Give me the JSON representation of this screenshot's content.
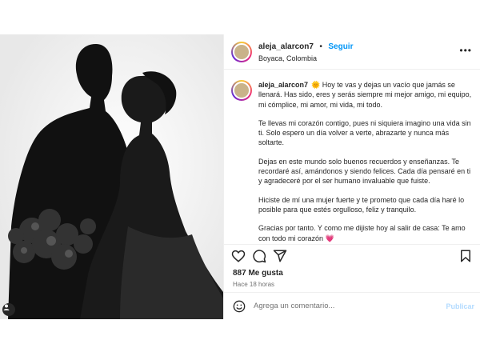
{
  "post": {
    "username": "aleja_alarcon7",
    "separator": "•",
    "follow_label": "Seguir",
    "location": "Boyaca, Colombia",
    "more_icon": "more-horizontal-icon",
    "tag_icon": "user-tag-icon"
  },
  "caption": {
    "username": "aleja_alarcon7",
    "paragraphs": [
      "🌞 Hoy te vas y dejas un vacío que jamás se llenará. Has sido, eres y serás siempre mi mejor amigo, mi equipo, mi cómplice, mi amor, mi vida, mi todo.",
      "Te llevas mi corazón contigo, pues ni siquiera imagino una vida sin ti. Solo espero un día volver a verte, abrazarte y nunca más soltarte.",
      "Dejas en este mundo solo buenos recuerdos y enseñanzas. Te recordaré así, amándonos y siendo felices. Cada día pensaré en ti y agradeceré por el ser humano invaluable que fuiste.",
      "Hiciste de mí una mujer fuerte y te prometo que cada día haré lo posible para que estés orgulloso, feliz y tranquilo.",
      "Gracias por tanto. Y como me dijiste hoy al salir de casa: Te amo con todo mi corazón 💗"
    ]
  },
  "actions": {
    "like_icon": "heart-icon",
    "comment_icon": "comment-icon",
    "share_icon": "share-icon",
    "save_icon": "bookmark-icon"
  },
  "stats": {
    "likes": "887 Me gusta",
    "time": "Hace 18 horas"
  },
  "comment": {
    "emoji_icon": "emoji-icon",
    "placeholder": "Agrega un comentario...",
    "publish_label": "Publicar"
  }
}
